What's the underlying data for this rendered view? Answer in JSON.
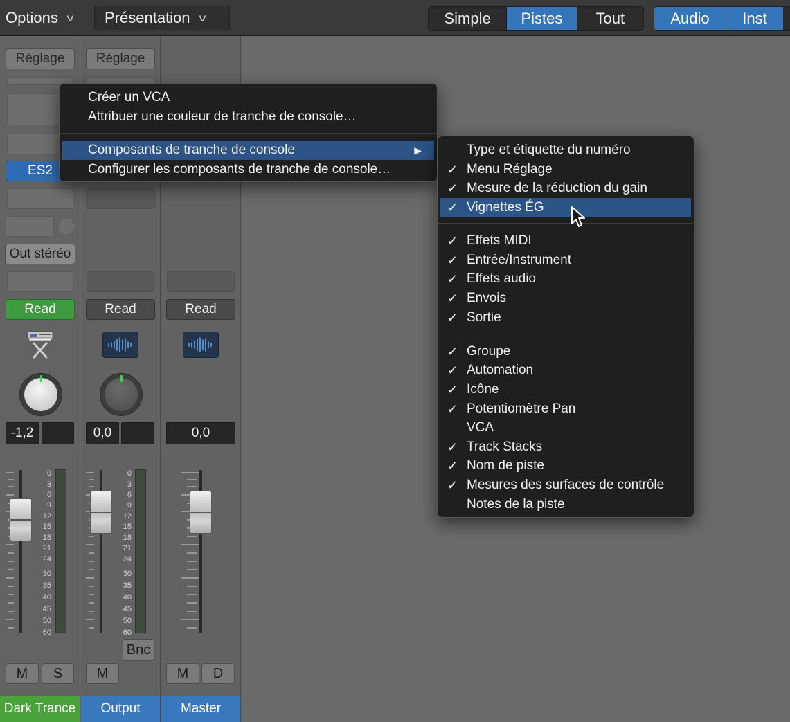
{
  "toolbar": {
    "options_label": "Options",
    "presentation_label": "Présentation",
    "view_buttons": [
      "Simple",
      "Pistes",
      "Tout"
    ],
    "view_active": "Pistes",
    "filter_buttons": [
      "Audio",
      "Inst"
    ]
  },
  "strips": [
    {
      "setting_label": "Réglage",
      "instrument_label": "ES2",
      "output_label": "Out stéréo",
      "automation": "Read",
      "pan_value": "-1,2",
      "mute_label": "M",
      "solo_label": "S",
      "name": "Dark Trance"
    },
    {
      "setting_label": "Réglage",
      "automation": "Read",
      "pan_value": "0,0",
      "bounce_label": "Bnc",
      "mute_label": "M",
      "name": "Output"
    },
    {
      "automation": "Read",
      "pan_value": "0,0",
      "mute_label": "M",
      "dim_label": "D",
      "name": "Master"
    }
  ],
  "meter_scale": [
    "0",
    "3",
    "6",
    "9",
    "12",
    "15",
    "18",
    "21",
    "24",
    "30",
    "35",
    "40",
    "45",
    "50",
    "60"
  ],
  "context_menu": {
    "items": [
      {
        "label": "Créer un VCA"
      },
      {
        "label": "Attribuer une couleur de tranche de console…"
      },
      {
        "label": "Composants de tranche de console",
        "submenu": true,
        "highlighted": true
      },
      {
        "label": "Configurer les composants de tranche de console…"
      }
    ]
  },
  "submenu": {
    "items": [
      {
        "label": "Type et étiquette du numéro",
        "checked": false
      },
      {
        "label": "Menu Réglage",
        "checked": true
      },
      {
        "label": "Mesure de la réduction du gain",
        "checked": true
      },
      {
        "label": "Vignettes ÉG",
        "checked": true,
        "highlighted": true
      },
      {
        "label": "Effets MIDI",
        "checked": true
      },
      {
        "label": "Entrée/Instrument",
        "checked": true
      },
      {
        "label": "Effets audio",
        "checked": true
      },
      {
        "label": "Envois",
        "checked": true
      },
      {
        "label": "Sortie",
        "checked": true
      },
      {
        "label": "Groupe",
        "checked": true
      },
      {
        "label": "Automation",
        "checked": true
      },
      {
        "label": "Icône",
        "checked": true
      },
      {
        "label": "Potentiomètre Pan",
        "checked": true
      },
      {
        "label": "VCA",
        "checked": false
      },
      {
        "label": "Track Stacks",
        "checked": true
      },
      {
        "label": "Nom de piste",
        "checked": true
      },
      {
        "label": "Mesures des surfaces de contrôle",
        "checked": true
      },
      {
        "label": "Notes de la piste",
        "checked": false
      }
    ],
    "checkmark": "✓",
    "submenu_arrow": "▶"
  },
  "colors": {
    "accent_blue": "#3474b8",
    "highlight": "#2c5486",
    "read_green": "#3d9a3d",
    "track_green": "#4aa23a",
    "track_blue": "#3a78bd"
  }
}
